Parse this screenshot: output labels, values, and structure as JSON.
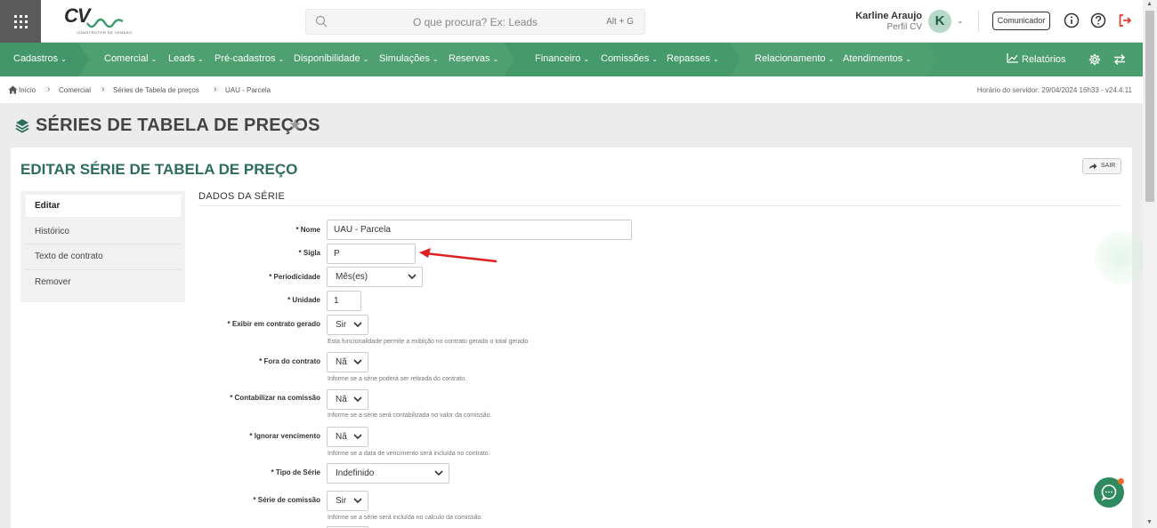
{
  "app": {
    "logo_text": "CV",
    "logo_subtitle": "CONSTRUTOR DE VENDAS"
  },
  "search": {
    "placeholder": "O que procura? Ex: Leads",
    "shortcut": "Alt + G"
  },
  "user": {
    "name": "Karline Araujo",
    "role": "Perfil CV",
    "initial": "K"
  },
  "header": {
    "communicator_label": "Comunicador"
  },
  "nav": {
    "items": [
      {
        "label": "Cadastros"
      },
      {
        "label": "Comercial"
      },
      {
        "label": "Leads"
      },
      {
        "label": "Pré-cadastros"
      },
      {
        "label": "Disponibilidade"
      },
      {
        "label": "Simulações"
      },
      {
        "label": "Reservas"
      },
      {
        "label": "Financeiro"
      },
      {
        "label": "Comissões"
      },
      {
        "label": "Repasses"
      },
      {
        "label": "Relacionamento"
      },
      {
        "label": "Atendimentos"
      }
    ],
    "reports_label": "Relatórios",
    "colors": {
      "primary": "#4a9d6e",
      "secondary": "#3f8f62"
    }
  },
  "breadcrumb": {
    "items": [
      "Início",
      "Comercial",
      "Séries de Tabela de preços",
      "UAU - Parcela"
    ],
    "server_time": "Horário do servidor: 29/04/2024 16h33 - v24.4.11"
  },
  "page": {
    "title": "SÉRIES DE TABELA DE PREÇOS"
  },
  "card": {
    "title": "EDITAR SÉRIE DE TABELA DE PREÇO",
    "exit_label": "SAIR",
    "section_title": "DADOS DA SÉRIE"
  },
  "side_menu": {
    "items": [
      "Editar",
      "Histórico",
      "Texto de contrato",
      "Remover"
    ]
  },
  "form": {
    "nome": {
      "label": "* Nome",
      "value": "UAU - Parcela"
    },
    "sigla": {
      "label": "* Sigla",
      "value": "P"
    },
    "periodicidade": {
      "label": "* Periodicidade",
      "value": "Mês(es)"
    },
    "unidade": {
      "label": "* Unidade",
      "value": "1"
    },
    "exibir": {
      "label": "* Exibir em contrato gerado",
      "value": "Sir",
      "help": "Esta funcionalidade permite a exibição no contrato gerado o total gerado"
    },
    "fora": {
      "label": "* Fora do contrato",
      "value": "Nã",
      "help": "Informe se a série poderá ser retirada do contrato."
    },
    "contabilizar": {
      "label": "* Contabilizar na comissão",
      "value": "Nã",
      "help": "Informe se a série será contabilizada no valor da comissão."
    },
    "ignorar": {
      "label": "* Ignorar vencimento",
      "value": "Nã",
      "help": "Informe se a data de vencimento será incluída no contrato."
    },
    "tipo": {
      "label": "* Tipo de Série",
      "value": "Indefinido"
    },
    "serie_comissao": {
      "label": "* Série de comissão",
      "value": "Sir",
      "help": "Informe se a série será incluída no calculo da comissão."
    }
  }
}
